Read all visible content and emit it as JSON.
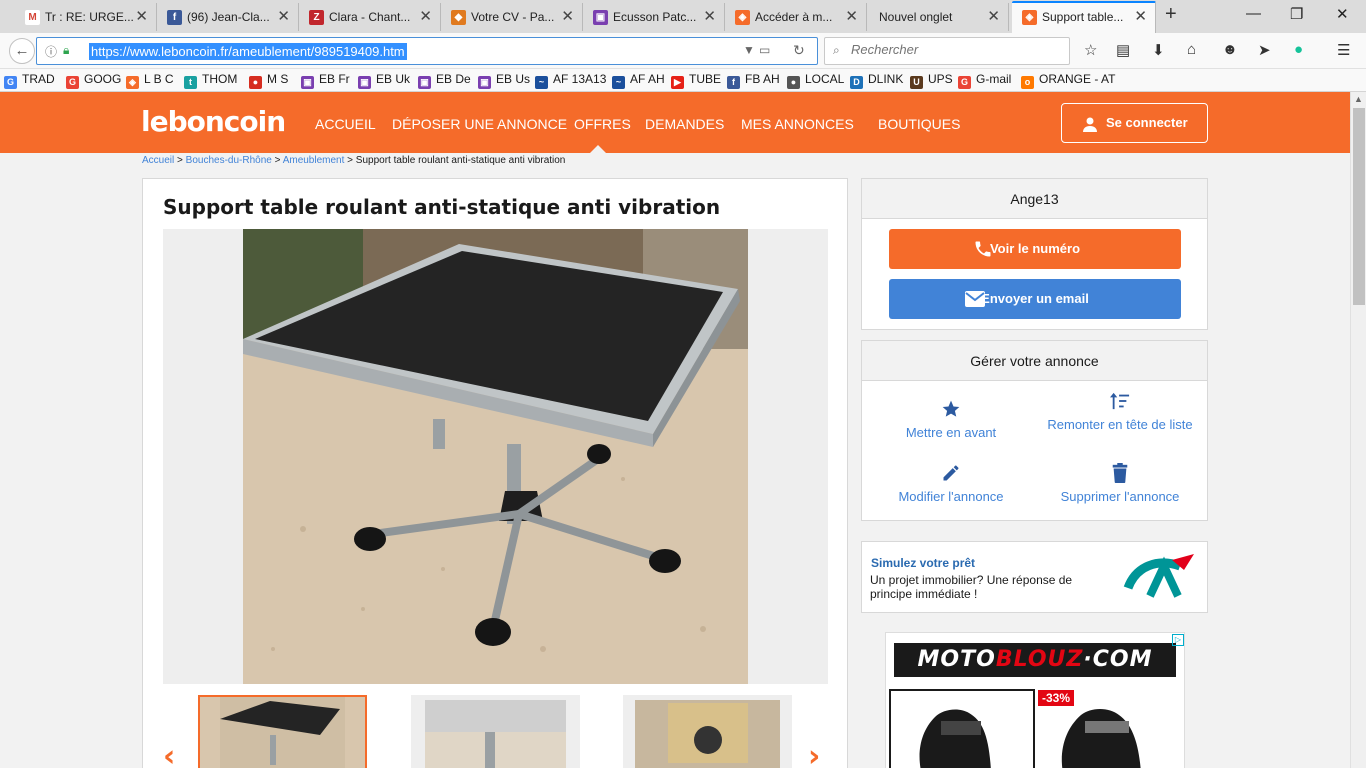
{
  "browser": {
    "tabs": [
      {
        "title": "Tr : RE: URGE...",
        "icon": "gmail-icon",
        "color": "#d44638",
        "glyph": "M"
      },
      {
        "title": "(96) Jean-Cla...",
        "icon": "facebook-icon",
        "color": "#3b5998",
        "glyph": "f"
      },
      {
        "title": "Clara - Chant...",
        "icon": "z-icon",
        "color": "#c1272d",
        "glyph": "Z"
      },
      {
        "title": "Votre CV - Pa...",
        "icon": "cv-icon",
        "color": "#e07a1f",
        "glyph": "◆"
      },
      {
        "title": "Ecusson Patc...",
        "icon": "ebay-icon",
        "color": "#7a3fb0",
        "glyph": "▣"
      },
      {
        "title": "Accéder à m...",
        "icon": "leboncoin-icon",
        "color": "#f56b2a",
        "glyph": "◈"
      },
      {
        "title": "Nouvel onglet",
        "icon": "",
        "color": "",
        "glyph": ""
      },
      {
        "title": "Support table...",
        "icon": "leboncoin-icon",
        "color": "#f56b2a",
        "glyph": "◈"
      }
    ],
    "url": "https://www.leboncoin.fr/ameublement/989519409.htm",
    "search_placeholder": "Rechercher",
    "bookmarks": [
      {
        "label": "TRAD",
        "color": "#4285f4",
        "glyph": "G"
      },
      {
        "label": "GOOG",
        "color": "#ea4335",
        "glyph": "G"
      },
      {
        "label": "L B C",
        "color": "#f56b2a",
        "glyph": "◈"
      },
      {
        "label": "THOM",
        "color": "#1aa1a1",
        "glyph": "t"
      },
      {
        "label": "M S",
        "color": "#d62d20",
        "glyph": "●"
      },
      {
        "label": "EB Fr",
        "color": "#7a3fb0",
        "glyph": "▣"
      },
      {
        "label": "EB Uk",
        "color": "#7a3fb0",
        "glyph": "▣"
      },
      {
        "label": "EB De",
        "color": "#7a3fb0",
        "glyph": "▣"
      },
      {
        "label": "EB Us",
        "color": "#7a3fb0",
        "glyph": "▣"
      },
      {
        "label": "AF 13A13",
        "color": "#1b4f9c",
        "glyph": "~"
      },
      {
        "label": "AF AH",
        "color": "#1b4f9c",
        "glyph": "~"
      },
      {
        "label": "TUBE",
        "color": "#e62117",
        "glyph": "▶"
      },
      {
        "label": "FB AH",
        "color": "#3b5998",
        "glyph": "f"
      },
      {
        "label": "LOCAL",
        "color": "#555555",
        "glyph": "●"
      },
      {
        "label": "DLINK",
        "color": "#1d71b8",
        "glyph": "D"
      },
      {
        "label": "UPS",
        "color": "#5b3a1e",
        "glyph": "U"
      },
      {
        "label": "G-mail",
        "color": "#ea4335",
        "glyph": "G"
      },
      {
        "label": "ORANGE - AT",
        "color": "#ff7900",
        "glyph": "o"
      }
    ]
  },
  "site": {
    "logo": "leboncoin",
    "nav": [
      "ACCUEIL",
      "DÉPOSER UNE ANNONCE",
      "OFFRES",
      "DEMANDES",
      "MES ANNONCES",
      "BOUTIQUES"
    ],
    "connect_label": "Se connecter",
    "accent_color": "#f56b2a",
    "link_color": "#4183d7"
  },
  "breadcrumb": {
    "items": [
      "Accueil",
      "Bouches-du-Rhône",
      "Ameublement"
    ],
    "current": "Support table roulant anti-statique anti vibration",
    "separator": ">"
  },
  "listing": {
    "title": "Support table roulant anti-statique anti vibration"
  },
  "seller": {
    "name": "Ange13",
    "call_label": "Voir le numéro",
    "email_label": "Envoyer un email"
  },
  "manage": {
    "heading": "Gérer votre annonce",
    "actions": [
      {
        "label": "Mettre en avant",
        "icon": "star-icon"
      },
      {
        "label": "Remonter en tête de liste",
        "icon": "sort-up-icon"
      },
      {
        "label": "Modifier l'annonce",
        "icon": "pencil-icon"
      },
      {
        "label": "Supprimer l'annonce",
        "icon": "trash-icon"
      }
    ]
  },
  "promo": {
    "title": "Simulez votre prêt",
    "text": "Un projet immobilier? Une réponse de principe immédiate !"
  },
  "ad": {
    "brand_part1": "MOTO",
    "brand_part2": "BLOUZ",
    "brand_part3": "·COM",
    "discount": "-33%"
  }
}
